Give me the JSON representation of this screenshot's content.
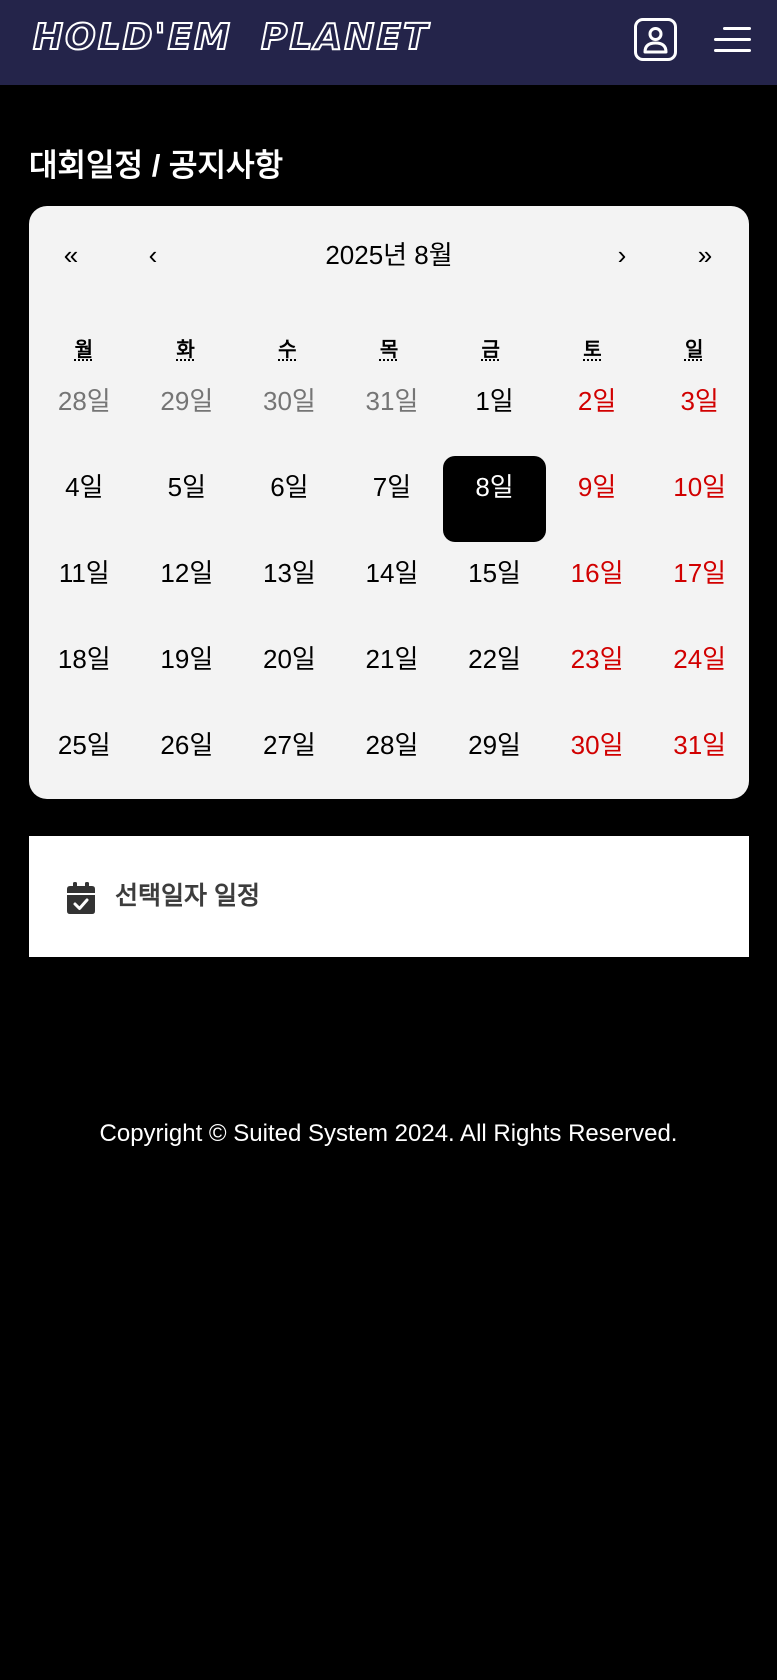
{
  "header": {
    "logo_text": "HOLD'EM  PLANET",
    "user_icon": "user-profile-icon",
    "menu_icon": "hamburger-menu-icon"
  },
  "page_title": "대회일정 / 공지사항",
  "calendar": {
    "prev_year_label": "«",
    "prev_month_label": "‹",
    "month_title": "2025년 8월",
    "next_month_label": "›",
    "next_year_label": "»",
    "weekdays": [
      "월",
      "화",
      "수",
      "목",
      "금",
      "토",
      "일"
    ],
    "days": [
      {
        "label": "28일",
        "type": "other-month"
      },
      {
        "label": "29일",
        "type": "other-month"
      },
      {
        "label": "30일",
        "type": "other-month"
      },
      {
        "label": "31일",
        "type": "other-month"
      },
      {
        "label": "1일",
        "type": "weekday-c"
      },
      {
        "label": "2일",
        "type": "weekend"
      },
      {
        "label": "3일",
        "type": "weekend"
      },
      {
        "label": "4일",
        "type": "weekday-c"
      },
      {
        "label": "5일",
        "type": "weekday-c"
      },
      {
        "label": "6일",
        "type": "weekday-c"
      },
      {
        "label": "7일",
        "type": "weekday-c"
      },
      {
        "label": "8일",
        "type": "selected"
      },
      {
        "label": "9일",
        "type": "weekend"
      },
      {
        "label": "10일",
        "type": "weekend"
      },
      {
        "label": "11일",
        "type": "weekday-c"
      },
      {
        "label": "12일",
        "type": "weekday-c"
      },
      {
        "label": "13일",
        "type": "weekday-c"
      },
      {
        "label": "14일",
        "type": "weekday-c"
      },
      {
        "label": "15일",
        "type": "weekday-c"
      },
      {
        "label": "16일",
        "type": "weekend"
      },
      {
        "label": "17일",
        "type": "weekend"
      },
      {
        "label": "18일",
        "type": "weekday-c"
      },
      {
        "label": "19일",
        "type": "weekday-c"
      },
      {
        "label": "20일",
        "type": "weekday-c"
      },
      {
        "label": "21일",
        "type": "weekday-c"
      },
      {
        "label": "22일",
        "type": "weekday-c"
      },
      {
        "label": "23일",
        "type": "weekend"
      },
      {
        "label": "24일",
        "type": "weekend"
      },
      {
        "label": "25일",
        "type": "weekday-c"
      },
      {
        "label": "26일",
        "type": "weekday-c"
      },
      {
        "label": "27일",
        "type": "weekday-c"
      },
      {
        "label": "28일",
        "type": "weekday-c"
      },
      {
        "label": "29일",
        "type": "weekday-c"
      },
      {
        "label": "30일",
        "type": "weekend"
      },
      {
        "label": "31일",
        "type": "weekend"
      }
    ]
  },
  "schedule": {
    "icon": "calendar-check-icon",
    "title": "선택일자 일정"
  },
  "footer": {
    "copyright": "Copyright © Suited System 2024. All Rights Reserved."
  },
  "colors": {
    "header_bg": "#24244a",
    "page_bg": "#000000",
    "calendar_bg": "#f3f3f3",
    "weekend": "#d10000",
    "other_month": "#757575",
    "selected_bg": "#000000"
  }
}
